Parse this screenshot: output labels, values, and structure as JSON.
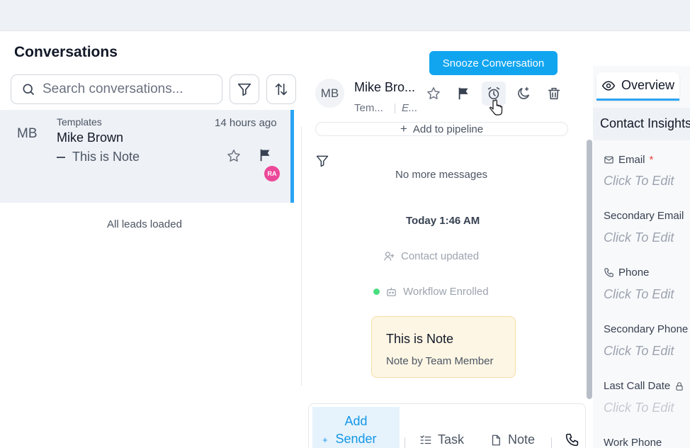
{
  "left": {
    "title": "Conversations",
    "search_placeholder": "Search conversations...",
    "conversation": {
      "avatar": "MB",
      "tag": "Templates",
      "name": "Mike Brown",
      "preview": "This is Note",
      "time": "14 hours ago",
      "assignee_badge": "RA"
    },
    "footer": "All leads loaded"
  },
  "header": {
    "avatar": "MB",
    "name": "Mike Bro...",
    "sub1": "Tem...",
    "sub2": "E...",
    "tooltip": "Snooze Conversation",
    "pipeline_label": "Add to pipeline"
  },
  "messages": {
    "no_more": "No more messages",
    "date": "Today 1:46 AM",
    "event1": "Contact updated",
    "event2": "Workflow Enrolled",
    "note_title": "This is Note",
    "note_by": "Note by Team Member"
  },
  "composer": {
    "add_sender_line1": "Add",
    "add_sender_line2": "Sender",
    "task": "Task",
    "note": "Note"
  },
  "right": {
    "overview_tab": "Overview",
    "insights_title": "Contact Insights",
    "fields": [
      {
        "label": "Email",
        "value": "Click To Edit"
      },
      {
        "label": "Secondary Email",
        "value": "Click To Edit"
      },
      {
        "label": "Phone",
        "value": "Click To Edit"
      },
      {
        "label": "Secondary Phone",
        "value": "Click To Edit"
      },
      {
        "label": "Last Call Date",
        "value": "Click To Edit"
      },
      {
        "label": "Work Phone",
        "value": ""
      }
    ]
  },
  "colors": {
    "accent": "#2aa4f4",
    "tooltip": "#11a5f0",
    "badge": "#ec4899",
    "note_bg": "#fef6e4",
    "status_dot": "#4ade80"
  }
}
